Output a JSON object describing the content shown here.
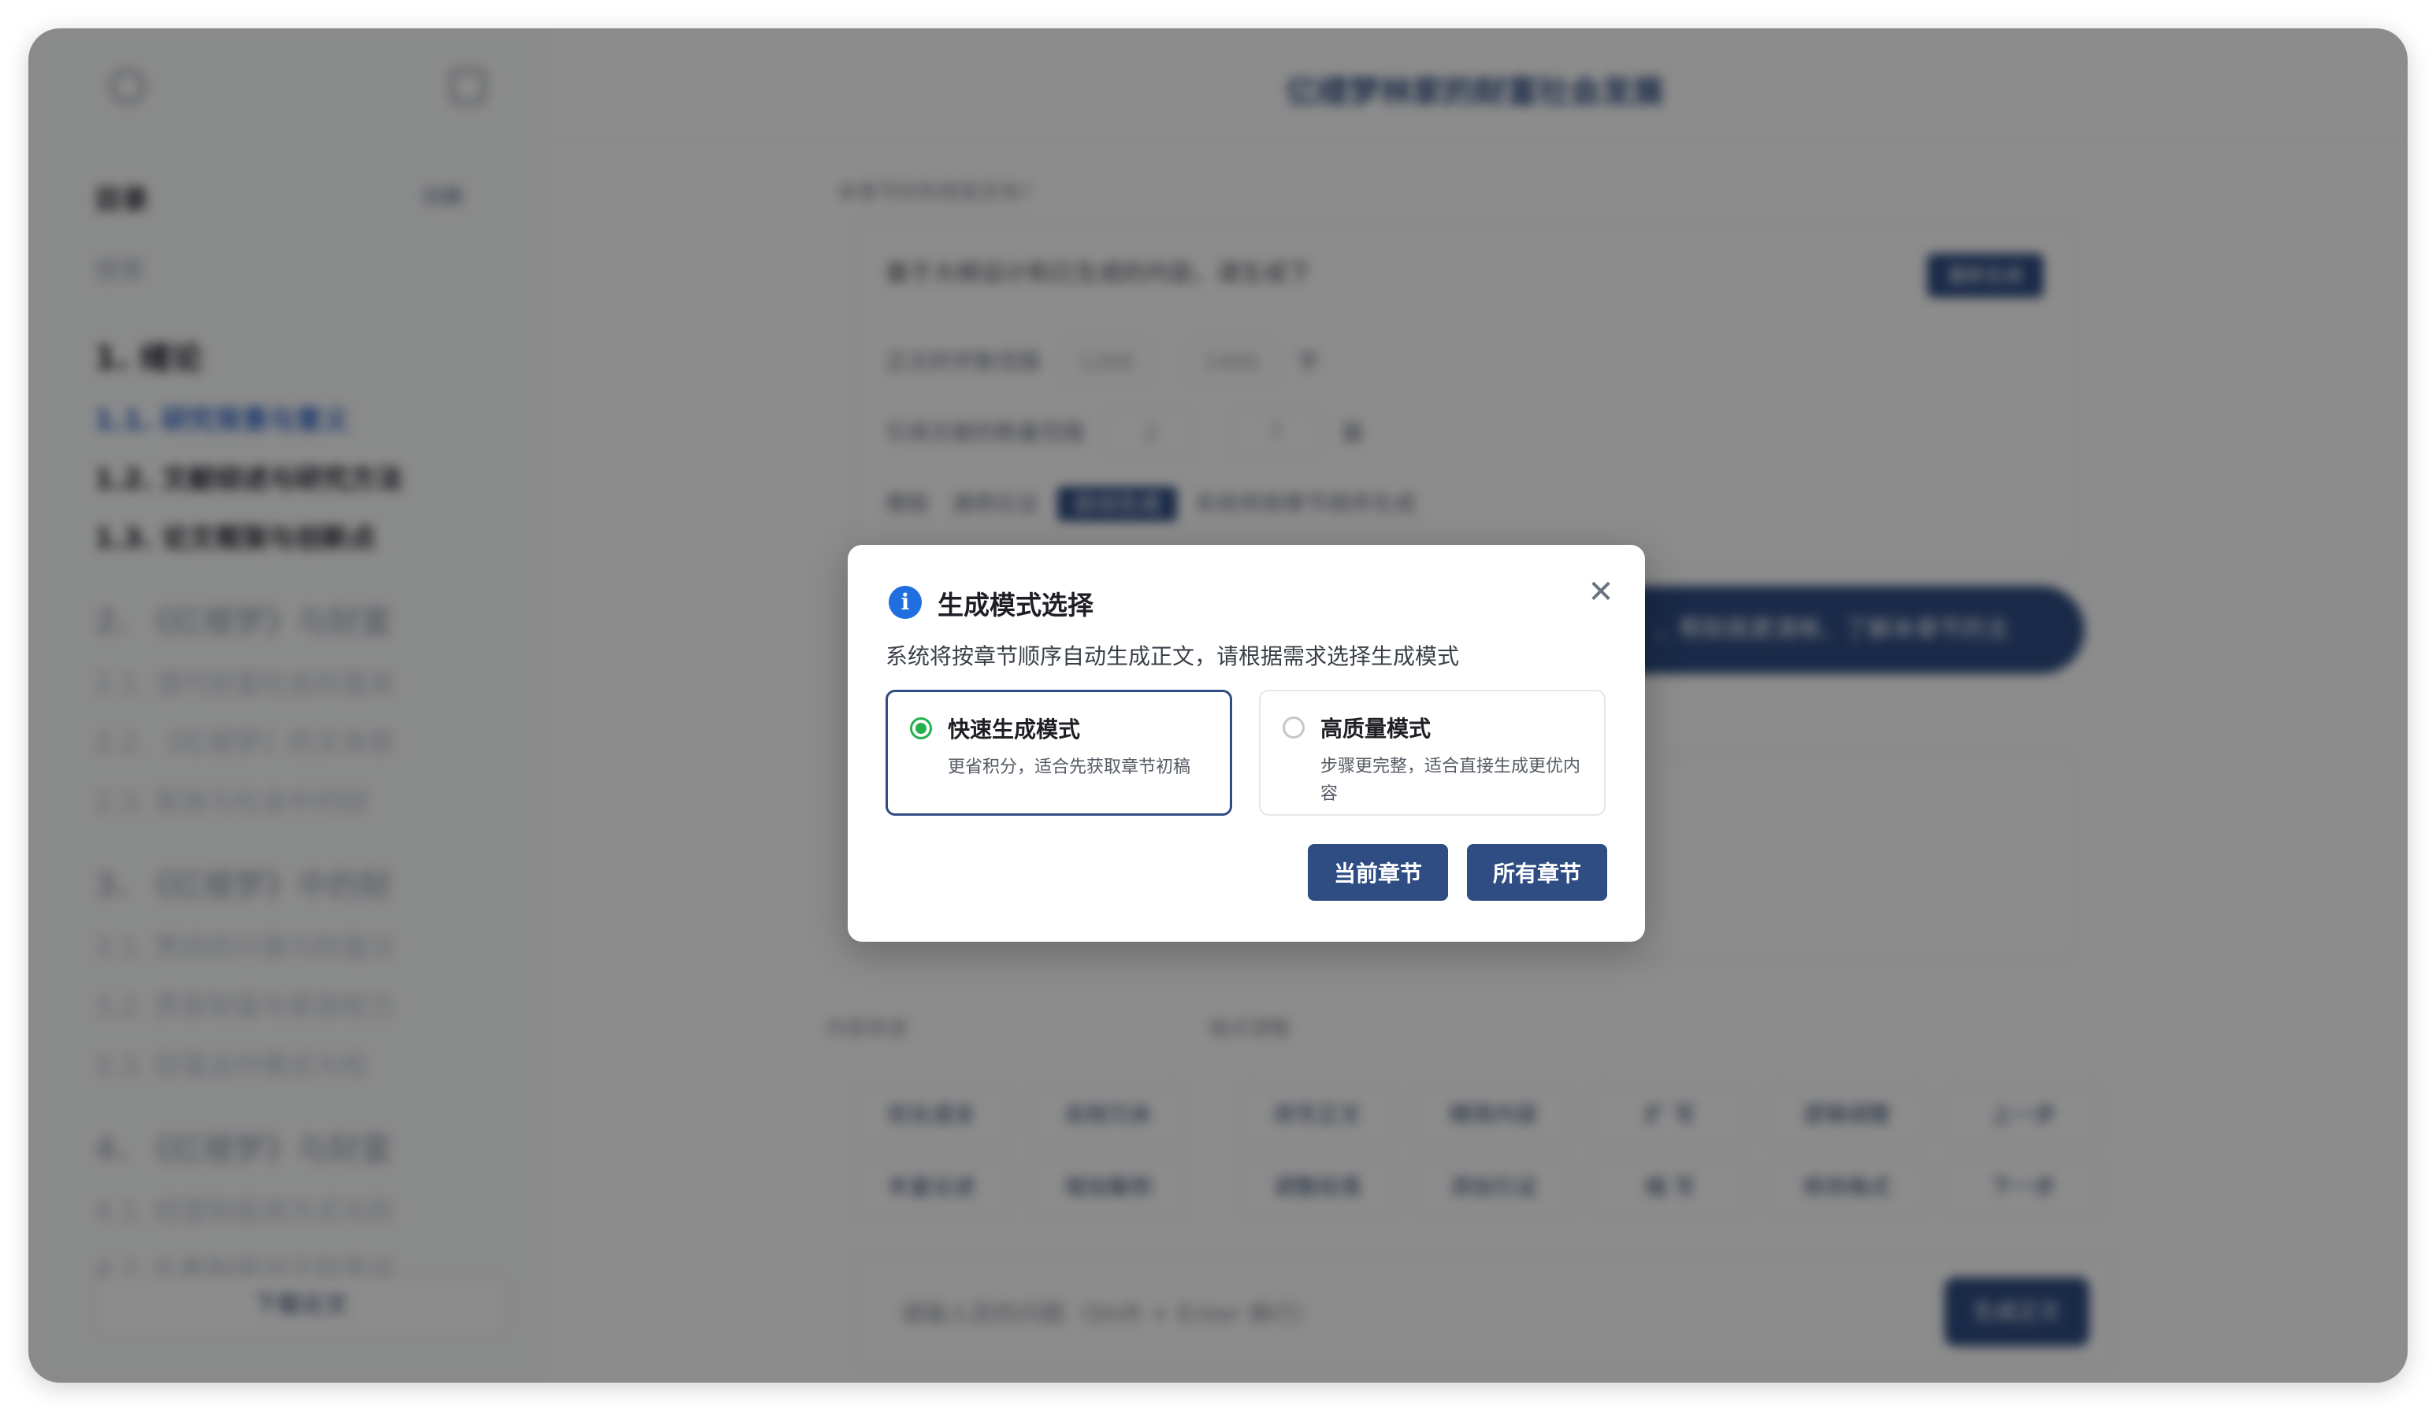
{
  "app": {
    "document_title": "亿缕梦林家的财富社会发展",
    "sidebar": {
      "title": "目录",
      "switch_label": "切换",
      "search_label": "搜索",
      "toc": [
        {
          "kind": "ch",
          "label": "1. 绪论"
        },
        {
          "kind": "sec",
          "label": "1.1. 研究背景与意义",
          "state": "active"
        },
        {
          "kind": "sec",
          "label": "1.2. 文献综述与研究方法"
        },
        {
          "kind": "sec",
          "label": "1.3. 论文框架与创新点"
        },
        {
          "kind": "ch",
          "label": "2. 《红楼梦》与财富",
          "state": "dim"
        },
        {
          "kind": "sec",
          "label": "2.1. 清代财富社会的基本",
          "state": "dim"
        },
        {
          "kind": "sec",
          "label": "2.2. 《红楼梦》的文本依",
          "state": "dim"
        },
        {
          "kind": "sec",
          "label": "2.3. 家族与社会中的财",
          "state": "dim"
        },
        {
          "kind": "ch",
          "label": "3. 《红楼梦》中的财",
          "state": "dim"
        },
        {
          "kind": "sec",
          "label": "3.1. 贾府的兴衰与财富分",
          "state": "dim"
        },
        {
          "kind": "sec",
          "label": "3.2. 贾家财富与家族权力",
          "state": "dim"
        },
        {
          "kind": "sec",
          "label": "3.3. 财富运作模式与权",
          "state": "dim"
        },
        {
          "kind": "ch",
          "label": "4. 《红楼梦》与财富",
          "state": "dim"
        },
        {
          "kind": "sec",
          "label": "4.1. 经营和投资方式与形",
          "state": "dim"
        },
        {
          "kind": "sec",
          "label": "4.2. 礼教制度对于财富运",
          "state": "dim"
        }
      ],
      "download_label": "下载论文"
    },
    "main": {
      "hint_label": "本章节的构想是否有?",
      "question": "基于大纲设计和已生成的内容，请生成下",
      "regen_label": "重新生成",
      "row1_label": "正文的字数范围",
      "row1_min": "1200",
      "row1_max": "1400",
      "row1_unit": "字",
      "row2_label": "引用文献的数量范围",
      "row2_min": "2",
      "row2_max": "7",
      "row2_unit": "篇",
      "row3_prefix": "模板",
      "row3_mid": "通用论证",
      "row3_tag": "自动生成",
      "row3_suffix": "系统将按章节顺序生成",
      "pill_label": "、帮助我更清晰、了解本章节的主",
      "group1_label": "内容改进",
      "group2_label": "格式调整",
      "tools_row1": [
        "优化语言",
        "去除冗余",
        "改写正文",
        "精简内容",
        "扩 写",
        "逻辑调整",
        "上一步"
      ],
      "tools_row2": [
        "丰富论述",
        "增加案例",
        "调整段落",
        "添加引证",
        "缩 写",
        "修改格式",
        "下一步"
      ],
      "input_placeholder": "请输入您的问题（Shift + Enter 换行）",
      "send_label": "生成正文"
    }
  },
  "modal": {
    "title": "生成模式选择",
    "description": "系统将按章节顺序自动生成正文，请根据需求选择生成模式",
    "options": [
      {
        "title": "快速生成模式",
        "desc": "更省积分，适合先获取章节初稿",
        "selected": true
      },
      {
        "title": "高质量模式",
        "desc": "步骤更完整，适合直接生成更优内容",
        "selected": false
      }
    ],
    "buttons": {
      "current": "当前章节",
      "all": "所有章节"
    },
    "close_icon": "close-icon",
    "info_icon": "info-icon",
    "colors": {
      "primary": "#2f4d83",
      "radio_selected": "#22b14c",
      "info": "#1f6fe0"
    }
  }
}
